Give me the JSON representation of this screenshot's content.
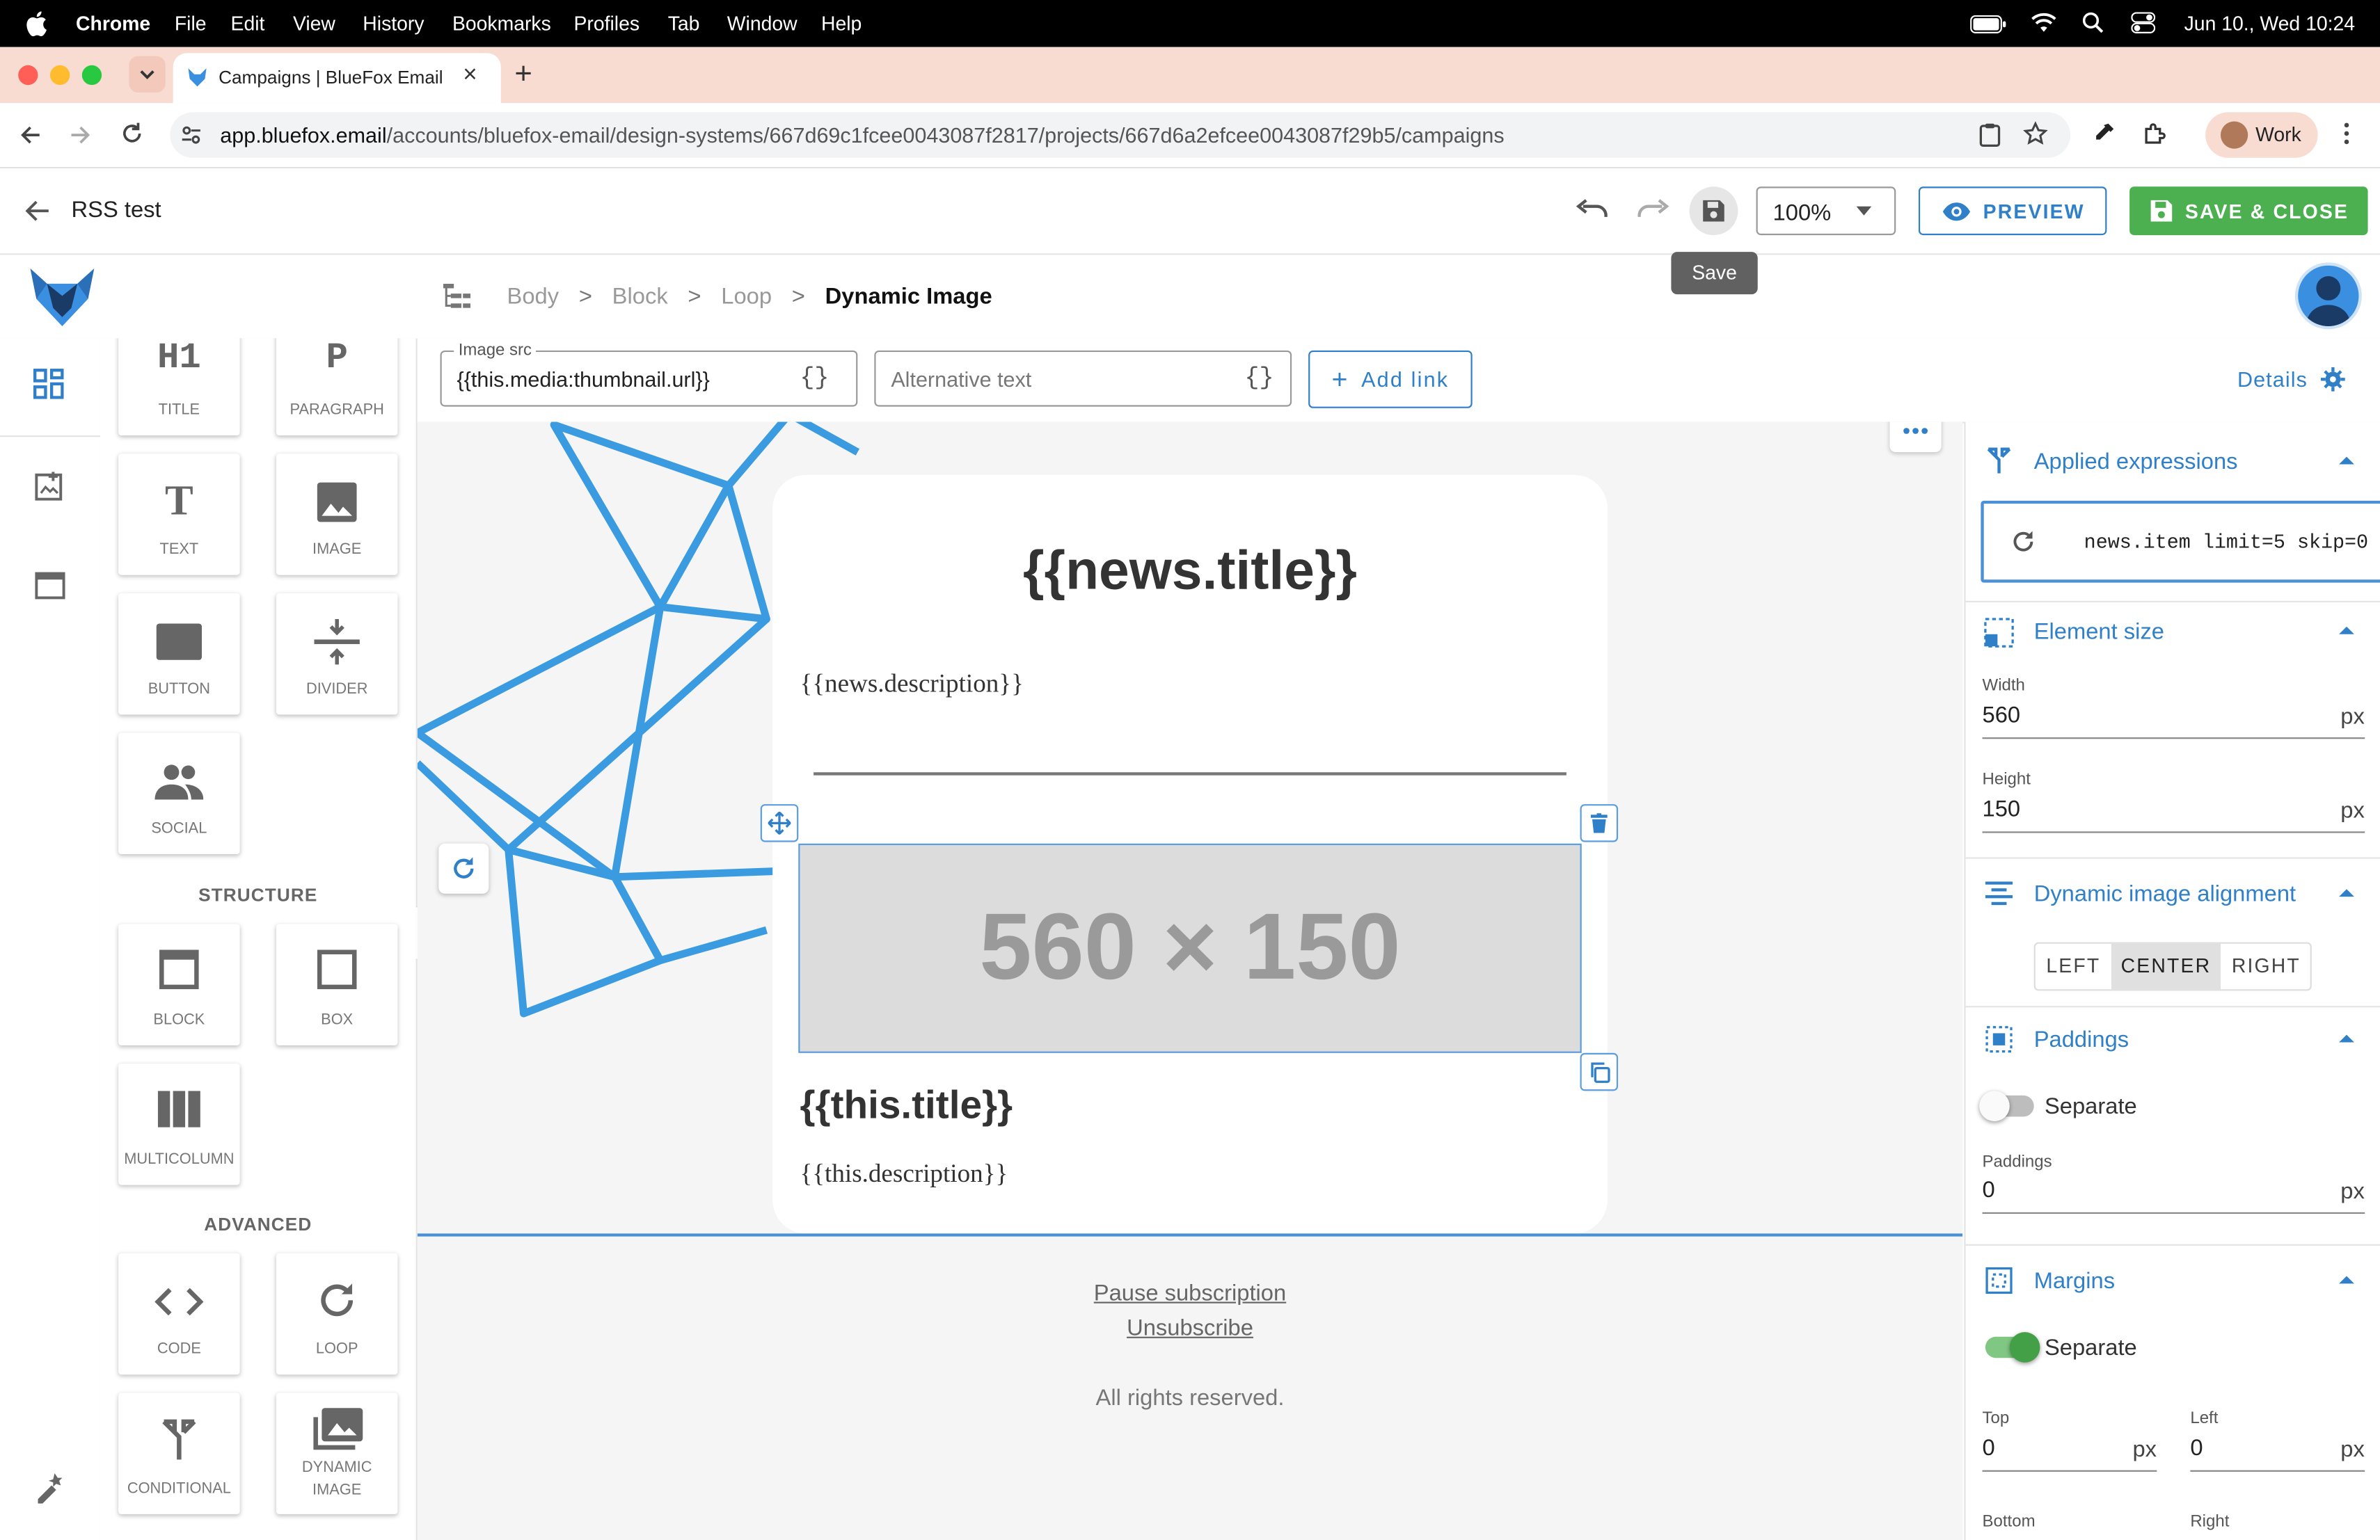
{
  "menubar": {
    "app_name": "Chrome",
    "menus": [
      "File",
      "Edit",
      "View",
      "History",
      "Bookmarks",
      "Profiles",
      "Tab",
      "Window",
      "Help"
    ],
    "datetime": "Jun 10., Wed  10:24"
  },
  "browser": {
    "tab_title": "Campaigns | BlueFox Email",
    "url_domain": "app.bluefox.email",
    "url_path": "/accounts/bluefox-email/design-systems/667d69c1fcee0043087f2817/projects/667d6a2efcee0043087f29b5/campaigns",
    "profile_label": "Work"
  },
  "header": {
    "title": "RSS test",
    "zoom": "100%",
    "preview_label": "PREVIEW",
    "save_close_label": "SAVE & CLOSE",
    "save_tooltip": "Save"
  },
  "breadcrumb": {
    "items": [
      "Body",
      "Block",
      "Loop"
    ],
    "separator": ">",
    "current": "Dynamic Image"
  },
  "toolbar": {
    "image_src_label": "Image src",
    "image_src_value": "{{this.media:thumbnail.url}}",
    "alt_text_placeholder": "Alternative text",
    "braces_label": "{}",
    "add_link_label": "Add link",
    "details_label": "Details"
  },
  "palette": {
    "basic": [
      {
        "label": "TITLE",
        "glyph": "H1"
      },
      {
        "label": "PARAGRAPH",
        "glyph": "P"
      },
      {
        "label": "TEXT",
        "glyph": "T"
      },
      {
        "label": "IMAGE"
      },
      {
        "label": "BUTTON"
      },
      {
        "label": "DIVIDER"
      },
      {
        "label": "SOCIAL"
      }
    ],
    "structure_heading": "STRUCTURE",
    "structure": [
      {
        "label": "BLOCK"
      },
      {
        "label": "BOX"
      },
      {
        "label": "MULTICOLUMN"
      }
    ],
    "advanced_heading": "ADVANCED",
    "advanced": [
      {
        "label": "CODE"
      },
      {
        "label": "LOOP"
      },
      {
        "label": "CONDITIONAL"
      },
      {
        "label": "DYNAMIC",
        "label2": "IMAGE"
      }
    ]
  },
  "canvas": {
    "news_title": "{{news.title}}",
    "news_description": "{{news.description}}",
    "placeholder_image_text": "560 × 150",
    "item_title": "{{this.title}}",
    "item_description": "{{this.description}}",
    "footer_pause": "Pause subscription",
    "footer_unsubscribe": "Unsubscribe",
    "footer_rights": "All rights reserved."
  },
  "properties": {
    "applied_expressions": {
      "title": "Applied expressions",
      "expression": "news.item limit=5 skip=0"
    },
    "element_size": {
      "title": "Element size",
      "width_label": "Width",
      "width_value": "560",
      "height_label": "Height",
      "height_value": "150",
      "unit": "px"
    },
    "alignment": {
      "title": "Dynamic image alignment",
      "options": [
        "LEFT",
        "CENTER",
        "RIGHT"
      ],
      "selected": "CENTER"
    },
    "paddings": {
      "title": "Paddings",
      "separate_label": "Separate",
      "separate_on": false,
      "field_label": "Paddings",
      "value": "0",
      "unit": "px"
    },
    "margins": {
      "title": "Margins",
      "separate_label": "Separate",
      "separate_on": true,
      "top_label": "Top",
      "top_value": "0",
      "left_label": "Left",
      "left_value": "0",
      "bottom_label": "Bottom",
      "right_label": "Right",
      "unit": "px"
    }
  },
  "colors": {
    "accent": "#2f80c9",
    "green": "#4caf50",
    "tab_strip": "#f8dbd1"
  }
}
